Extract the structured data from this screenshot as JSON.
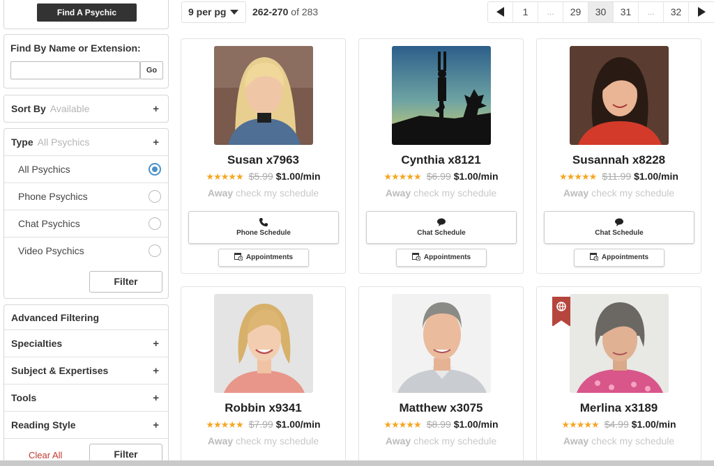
{
  "sidebar": {
    "find_button": "Find A Psychic",
    "find_by_name_label": "Find By Name or Extension:",
    "search_value": "",
    "go_label": "Go",
    "sort_label": "Sort By",
    "sort_value": "Available",
    "type_label": "Type",
    "type_value": "All Psychics",
    "type_options": [
      {
        "label": "All Psychics",
        "selected": true
      },
      {
        "label": "Phone Psychics",
        "selected": false
      },
      {
        "label": "Chat Psychics",
        "selected": false
      },
      {
        "label": "Video Psychics",
        "selected": false
      }
    ],
    "filter_label": "Filter",
    "advanced_label": "Advanced Filtering",
    "advanced_items": [
      "Specialties",
      "Subject & Expertises",
      "Tools",
      "Reading Style"
    ],
    "clear_all_label": "Clear All",
    "plus_symbol": "+"
  },
  "toolbar": {
    "per_page": "9 per pg",
    "range_bold": "262-270",
    "range_rest": "of 283"
  },
  "pagination": {
    "pages": [
      "1",
      "...",
      "29",
      "30",
      "31",
      "...",
      "32"
    ],
    "current": "30"
  },
  "status_away": "Away",
  "status_rest": "check my schedule",
  "appointments_label": "Appointments",
  "stars_text": "★★★★★",
  "psychics": [
    {
      "name": "Susan x7963",
      "old_price": "$5.99",
      "new_price": "$1.00/min",
      "schedule": "Phone Schedule",
      "schedule_icon": "phone-icon",
      "rating": 5
    },
    {
      "name": "Cynthia x8121",
      "old_price": "$6.99",
      "new_price": "$1.00/min",
      "schedule": "Chat Schedule",
      "schedule_icon": "chat-icon",
      "rating": 4.5
    },
    {
      "name": "Susannah x8228",
      "old_price": "$11.99",
      "new_price": "$1.00/min",
      "schedule": "Chat Schedule",
      "schedule_icon": "chat-icon",
      "rating": 5
    },
    {
      "name": "Robbin x9341",
      "old_price": "$7.99",
      "new_price": "$1.00/min",
      "rating": 5
    },
    {
      "name": "Matthew x3075",
      "old_price": "$8.99",
      "new_price": "$1.00/min",
      "rating": 5
    },
    {
      "name": "Merlina x3189",
      "old_price": "$4.99",
      "new_price": "$1.00/min",
      "rating": 5,
      "badge_icon": "globe-icon"
    }
  ],
  "colors": {
    "star": "#f5a623",
    "radio_selected": "#4a90c8",
    "ribbon": "#b6453e",
    "dark_button": "#333333"
  }
}
